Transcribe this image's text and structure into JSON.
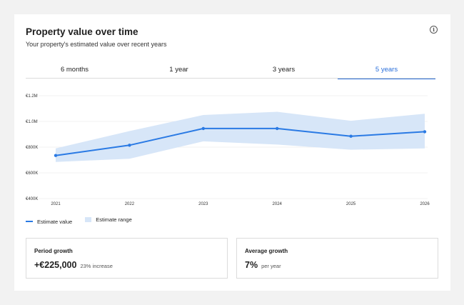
{
  "card": {
    "title": "Property value over time",
    "subtitle": "Your property's estimated value over recent years",
    "info_icon": "info-icon"
  },
  "tabs": [
    {
      "label": "6 months",
      "active": false
    },
    {
      "label": "1 year",
      "active": false
    },
    {
      "label": "3 years",
      "active": false
    },
    {
      "label": "5 years",
      "active": true
    }
  ],
  "colors": {
    "accent": "#2a6fdb",
    "line": "#2a7ae4",
    "range": "#d7e6f8",
    "grid": "#e6e6e6"
  },
  "chart_data": {
    "type": "line",
    "x": [
      "2021",
      "2022",
      "2023",
      "2024",
      "2025",
      "2026"
    ],
    "series": [
      {
        "name": "Estimate value",
        "values": [
          735000,
          815000,
          945000,
          945000,
          885000,
          920000
        ]
      }
    ],
    "range": {
      "name": "Estimate range",
      "low": [
        685000,
        710000,
        845000,
        820000,
        780000,
        790000
      ],
      "high": [
        790000,
        925000,
        1050000,
        1075000,
        1005000,
        1060000
      ]
    },
    "yticks": [
      "€400K",
      "€600K",
      "€800K",
      "€1.0M",
      "€1.2M"
    ],
    "ytick_values": [
      400000,
      600000,
      800000,
      1000000,
      1200000
    ],
    "ylim": [
      400000,
      1200000
    ],
    "grid": true,
    "legend": "bottom-left"
  },
  "legend": {
    "line_label": "Estimate value",
    "range_label": "Estimate range"
  },
  "stats": {
    "period": {
      "label": "Period growth",
      "value": "+€225,000",
      "note": "23% increase"
    },
    "average": {
      "label": "Average growth",
      "value": "7%",
      "note": "per year"
    }
  }
}
